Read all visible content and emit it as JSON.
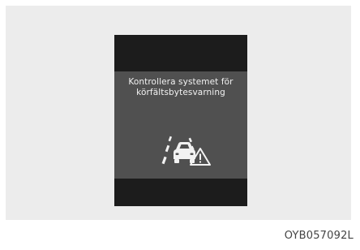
{
  "display": {
    "message_line1": "Kontrollera systemet för",
    "message_line2": "körfältsbytesvarning",
    "icon": "lane-change-warning-icon"
  },
  "caption": "OYB057092L",
  "colors": {
    "panel_background": "#ececec",
    "display_dark": "#1c1c1c",
    "display_mid": "#505050",
    "text": "#f2f2f2"
  }
}
